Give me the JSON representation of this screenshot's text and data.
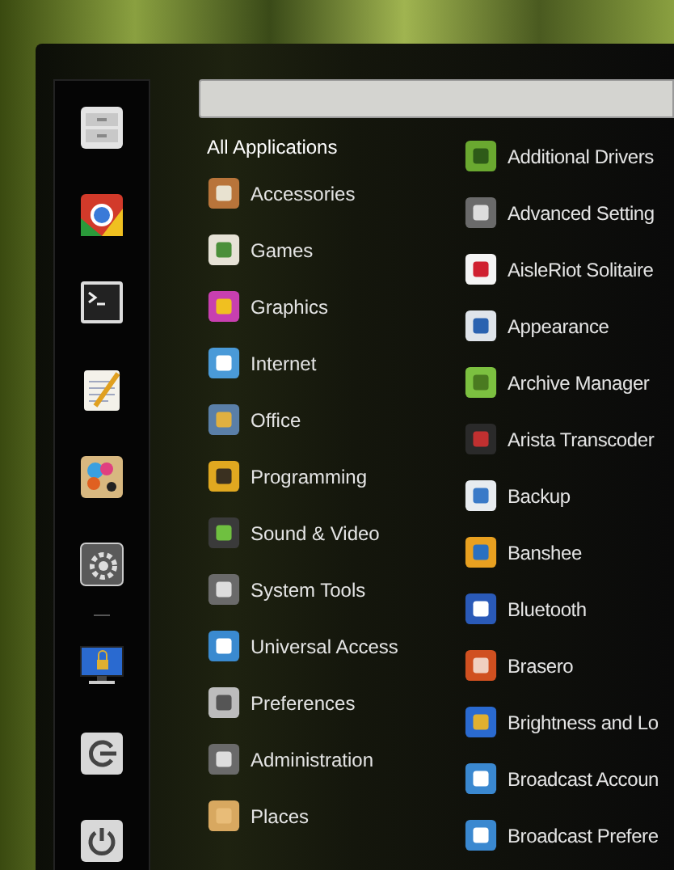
{
  "categories": [
    {
      "label": "All Applications",
      "selected": true
    },
    {
      "label": "Accessories",
      "selected": false
    },
    {
      "label": "Games",
      "selected": false
    },
    {
      "label": "Graphics",
      "selected": false
    },
    {
      "label": "Internet",
      "selected": false
    },
    {
      "label": "Office",
      "selected": false
    },
    {
      "label": "Programming",
      "selected": false
    },
    {
      "label": "Sound & Video",
      "selected": false
    },
    {
      "label": "System Tools",
      "selected": false
    },
    {
      "label": "Universal Access",
      "selected": false
    },
    {
      "label": "Preferences",
      "selected": false
    },
    {
      "label": "Administration",
      "selected": false
    },
    {
      "label": "Places",
      "selected": false
    }
  ],
  "applications": [
    "Additional Drivers",
    "Advanced Setting",
    "AisleRiot Solitaire",
    "Appearance",
    "Archive Manager",
    "Arista Transcoder",
    "Backup",
    "Banshee",
    "Bluetooth",
    "Brasero",
    "Brightness and Lo",
    "Broadcast Accoun",
    "Broadcast Prefere"
  ]
}
